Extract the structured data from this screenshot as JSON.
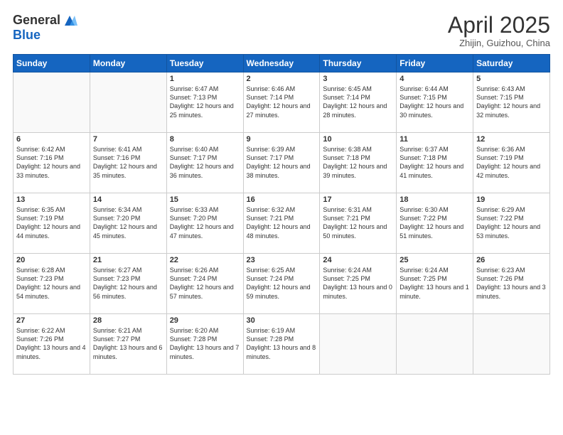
{
  "header": {
    "logo_general": "General",
    "logo_blue": "Blue",
    "month": "April 2025",
    "location": "Zhijin, Guizhou, China"
  },
  "days_of_week": [
    "Sunday",
    "Monday",
    "Tuesday",
    "Wednesday",
    "Thursday",
    "Friday",
    "Saturday"
  ],
  "weeks": [
    [
      {
        "num": "",
        "info": ""
      },
      {
        "num": "",
        "info": ""
      },
      {
        "num": "1",
        "info": "Sunrise: 6:47 AM\nSunset: 7:13 PM\nDaylight: 12 hours and 25 minutes."
      },
      {
        "num": "2",
        "info": "Sunrise: 6:46 AM\nSunset: 7:14 PM\nDaylight: 12 hours and 27 minutes."
      },
      {
        "num": "3",
        "info": "Sunrise: 6:45 AM\nSunset: 7:14 PM\nDaylight: 12 hours and 28 minutes."
      },
      {
        "num": "4",
        "info": "Sunrise: 6:44 AM\nSunset: 7:15 PM\nDaylight: 12 hours and 30 minutes."
      },
      {
        "num": "5",
        "info": "Sunrise: 6:43 AM\nSunset: 7:15 PM\nDaylight: 12 hours and 32 minutes."
      }
    ],
    [
      {
        "num": "6",
        "info": "Sunrise: 6:42 AM\nSunset: 7:16 PM\nDaylight: 12 hours and 33 minutes."
      },
      {
        "num": "7",
        "info": "Sunrise: 6:41 AM\nSunset: 7:16 PM\nDaylight: 12 hours and 35 minutes."
      },
      {
        "num": "8",
        "info": "Sunrise: 6:40 AM\nSunset: 7:17 PM\nDaylight: 12 hours and 36 minutes."
      },
      {
        "num": "9",
        "info": "Sunrise: 6:39 AM\nSunset: 7:17 PM\nDaylight: 12 hours and 38 minutes."
      },
      {
        "num": "10",
        "info": "Sunrise: 6:38 AM\nSunset: 7:18 PM\nDaylight: 12 hours and 39 minutes."
      },
      {
        "num": "11",
        "info": "Sunrise: 6:37 AM\nSunset: 7:18 PM\nDaylight: 12 hours and 41 minutes."
      },
      {
        "num": "12",
        "info": "Sunrise: 6:36 AM\nSunset: 7:19 PM\nDaylight: 12 hours and 42 minutes."
      }
    ],
    [
      {
        "num": "13",
        "info": "Sunrise: 6:35 AM\nSunset: 7:19 PM\nDaylight: 12 hours and 44 minutes."
      },
      {
        "num": "14",
        "info": "Sunrise: 6:34 AM\nSunset: 7:20 PM\nDaylight: 12 hours and 45 minutes."
      },
      {
        "num": "15",
        "info": "Sunrise: 6:33 AM\nSunset: 7:20 PM\nDaylight: 12 hours and 47 minutes."
      },
      {
        "num": "16",
        "info": "Sunrise: 6:32 AM\nSunset: 7:21 PM\nDaylight: 12 hours and 48 minutes."
      },
      {
        "num": "17",
        "info": "Sunrise: 6:31 AM\nSunset: 7:21 PM\nDaylight: 12 hours and 50 minutes."
      },
      {
        "num": "18",
        "info": "Sunrise: 6:30 AM\nSunset: 7:22 PM\nDaylight: 12 hours and 51 minutes."
      },
      {
        "num": "19",
        "info": "Sunrise: 6:29 AM\nSunset: 7:22 PM\nDaylight: 12 hours and 53 minutes."
      }
    ],
    [
      {
        "num": "20",
        "info": "Sunrise: 6:28 AM\nSunset: 7:23 PM\nDaylight: 12 hours and 54 minutes."
      },
      {
        "num": "21",
        "info": "Sunrise: 6:27 AM\nSunset: 7:23 PM\nDaylight: 12 hours and 56 minutes."
      },
      {
        "num": "22",
        "info": "Sunrise: 6:26 AM\nSunset: 7:24 PM\nDaylight: 12 hours and 57 minutes."
      },
      {
        "num": "23",
        "info": "Sunrise: 6:25 AM\nSunset: 7:24 PM\nDaylight: 12 hours and 59 minutes."
      },
      {
        "num": "24",
        "info": "Sunrise: 6:24 AM\nSunset: 7:25 PM\nDaylight: 13 hours and 0 minutes."
      },
      {
        "num": "25",
        "info": "Sunrise: 6:24 AM\nSunset: 7:25 PM\nDaylight: 13 hours and 1 minute."
      },
      {
        "num": "26",
        "info": "Sunrise: 6:23 AM\nSunset: 7:26 PM\nDaylight: 13 hours and 3 minutes."
      }
    ],
    [
      {
        "num": "27",
        "info": "Sunrise: 6:22 AM\nSunset: 7:26 PM\nDaylight: 13 hours and 4 minutes."
      },
      {
        "num": "28",
        "info": "Sunrise: 6:21 AM\nSunset: 7:27 PM\nDaylight: 13 hours and 6 minutes."
      },
      {
        "num": "29",
        "info": "Sunrise: 6:20 AM\nSunset: 7:28 PM\nDaylight: 13 hours and 7 minutes."
      },
      {
        "num": "30",
        "info": "Sunrise: 6:19 AM\nSunset: 7:28 PM\nDaylight: 13 hours and 8 minutes."
      },
      {
        "num": "",
        "info": ""
      },
      {
        "num": "",
        "info": ""
      },
      {
        "num": "",
        "info": ""
      }
    ]
  ]
}
